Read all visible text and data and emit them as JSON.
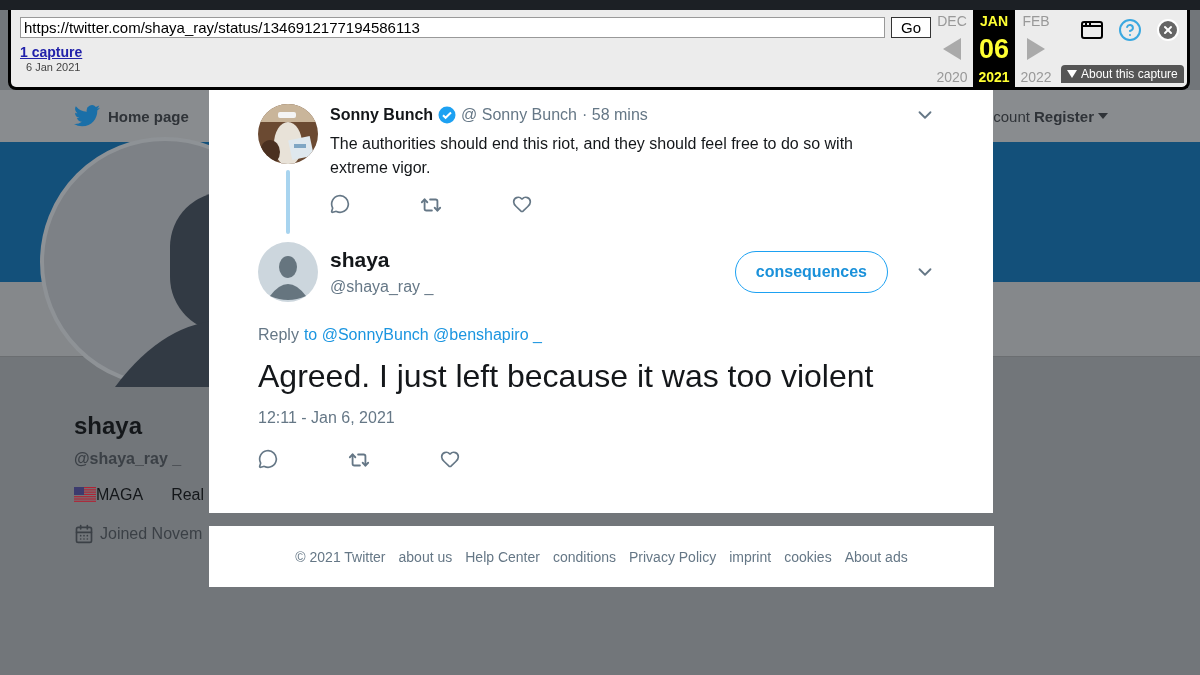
{
  "wayback": {
    "url": "https://twitter.com/shaya_ray/status/1346912177194586113",
    "go_button": "Go",
    "captures_link": "1 capture",
    "capture_date": "6 Jan 2021",
    "months": [
      {
        "label": "DEC",
        "selected": false
      },
      {
        "label": "JAN",
        "selected": true
      },
      {
        "label": "FEB",
        "selected": false
      }
    ],
    "day": "06",
    "years": [
      {
        "label": "2020",
        "selected": false
      },
      {
        "label": "2021",
        "selected": true
      },
      {
        "label": "2022",
        "selected": false
      }
    ],
    "about_button": "About this capture"
  },
  "nav": {
    "home": "Home page",
    "account_partial": "count",
    "register": "Register"
  },
  "profile": {
    "name": "shaya",
    "handle": "@shaya_ray _",
    "bio_items": [
      "MAGA",
      "Real"
    ],
    "joined": "Joined Novem"
  },
  "thread": {
    "parent": {
      "name": "Sonny Bunch",
      "verified": true,
      "handle": "@ Sonny Bunch",
      "time": "· 58 mins",
      "text": "The authorities should end this riot, and they should feel free to do so with extreme vigor."
    },
    "reply": {
      "name": "shaya",
      "handle": "@shaya_ray _",
      "follow_button": "consequences",
      "reply_label": "Reply",
      "reply_to": "to @SonnyBunch @benshapiro _",
      "text": "Agreed. I just left because it was too violent",
      "timestamp": "12:11 - Jan 6, 2021"
    }
  },
  "footer": [
    "© 2021 Twitter",
    "about us",
    "Help Center",
    "conditions",
    "Privacy Policy",
    "imprint",
    "cookies",
    "About ads"
  ]
}
